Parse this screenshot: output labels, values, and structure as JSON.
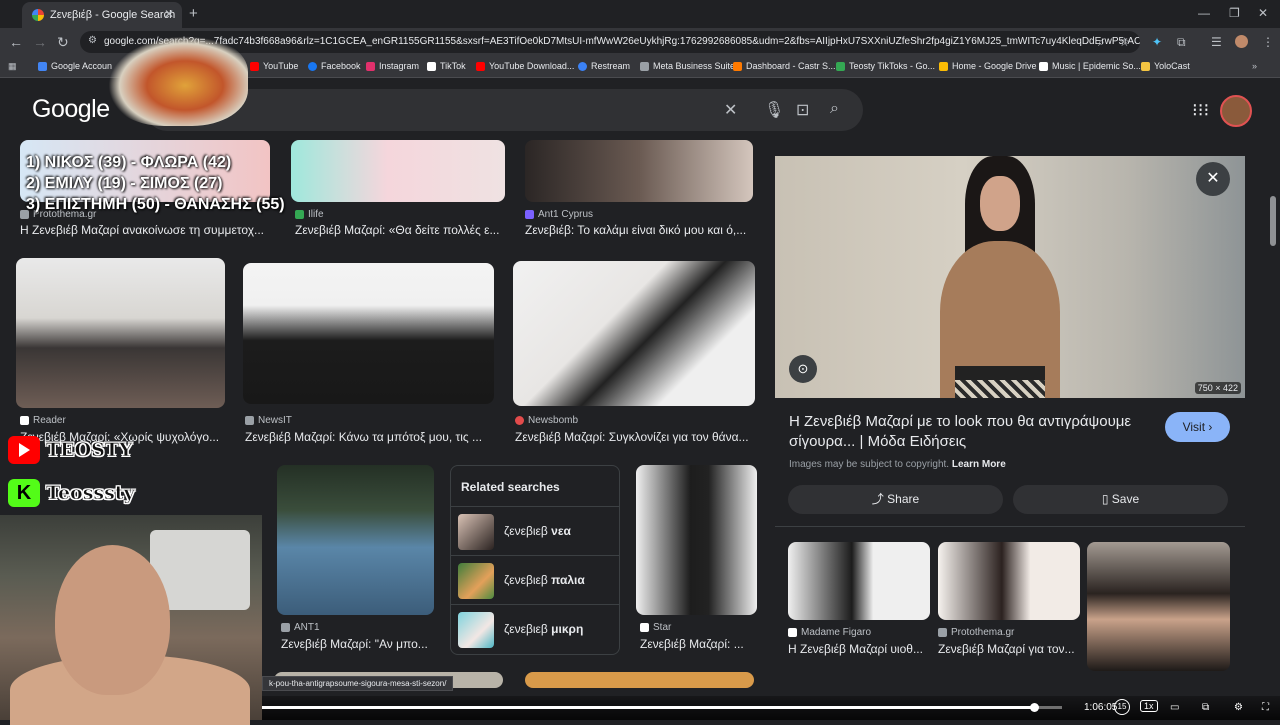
{
  "browser": {
    "tab_title": "Ζενεβιέβ - Google Search",
    "url": "google.com/search?q=...7fadc74b3f668a96&rlz=1C1GCEA_enGR1155GR1155&sxsrf=AE3TifOe0kD7MtsUI-mfWwW26eUykhjRg:1762992686085&udm=2&fbs=AIIjpHxU7SXXniUZfeShr2fp4giZ1Y6MJ25_tmWITc7uy4KleqDdErwP5rACeJA...",
    "bookmarks": [
      {
        "label": "Google Accoun",
        "color": "#4285f4"
      },
      {
        "label": "YouTube",
        "color": "#ff0000"
      },
      {
        "label": "Facebook",
        "color": "#1877f2"
      },
      {
        "label": "Instagram",
        "color": "#e1306c"
      },
      {
        "label": "TikTok",
        "color": "#ffffff"
      },
      {
        "label": "YouTube Download...",
        "color": "#ff0000"
      },
      {
        "label": "Restream",
        "color": "#3b82f6"
      },
      {
        "label": "Meta Business Suite",
        "color": "#9aa0a6"
      },
      {
        "label": "Dashboard - Castr S...",
        "color": "#ff7a00"
      },
      {
        "label": "Teosty TikToks - Go...",
        "color": "#34a853"
      },
      {
        "label": "Home - Google Drive",
        "color": "#fbbc05"
      },
      {
        "label": "Music | Epidemic So...",
        "color": "#ffffff"
      },
      {
        "label": "YoloCast",
        "color": "#f4c542"
      }
    ]
  },
  "google": {
    "logo": "Google",
    "search_value": ""
  },
  "overlay": {
    "line1": "1) ΝΙΚΟΣ (39) - ΦΛΩΡΑ (42)",
    "line2": "2) ΕΜΙΛΥ (19) - ΣΙΜΟΣ (27)",
    "line3": "3) ΕΠΙΣΤΗΜΗ (50) - ΘΑΝΑΣΗΣ (55)",
    "youtube_name": "TEOSTY",
    "kick_name": "Teosssty"
  },
  "results": [
    {
      "source": "Protothema.gr",
      "caption": "Η Ζενεβιέβ Μαζαρί ανακοίνωσε τη συμμετοχ...",
      "color": "#9aa0a6"
    },
    {
      "source": "Ilife",
      "caption": "Ζενεβιέβ Μαζαρί: «Θα δείτε πολλές ε...",
      "color": "#34a853"
    },
    {
      "source": "Ant1 Cyprus",
      "caption": "Ζενεβιέβ: Το καλάμι είναι δικό μου και ό,...",
      "color": "#7b61ff"
    },
    {
      "source": "Reader",
      "caption": "Ζενεβιέβ Μαζαρί: «Χωρίς ψυχολόγο...",
      "color": "#ffffff"
    },
    {
      "source": "NewsIT",
      "caption": "Ζενεβιέβ Μαζαρί: Κάνω τα μπότοξ μου, τις ...",
      "color": "#9aa0a6"
    },
    {
      "source": "Newsbomb",
      "caption": "Ζενεβιέβ Μαζαρί: Συγκλονίζει για τον θάνα...",
      "color": "#e24b4b"
    },
    {
      "source": "ANT1",
      "caption": "Ζενεβιέβ Μαζαρί: \"Αν μπο...",
      "color": "#9aa0a6"
    },
    {
      "source": "Star",
      "caption": "Ζενεβιέβ Μαζαρί: ...",
      "color": "#ffffff"
    }
  ],
  "related": {
    "title": "Related searches",
    "items": [
      {
        "base": "ζενεβιεβ",
        "bold": "νεα"
      },
      {
        "base": "ζενεβιεβ",
        "bold": "παλια"
      },
      {
        "base": "ζενεβιεβ",
        "bold": "μικρη"
      }
    ]
  },
  "panel": {
    "dimensions": "750 × 422",
    "title": "Η Ζενεβιέβ Μαζαρί με το look που θα αντιγράψουμε σίγουρα... | Μόδα Ειδήσεις",
    "visit_label": "Visit",
    "copyright": "Images may be subject to copyright.",
    "learn_more": "Learn More",
    "share_label": "Share",
    "save_label": "Save",
    "similar": [
      {
        "source": "Madame Figaro",
        "caption": "Η Ζενεβιέβ Μαζαρί υιοθ...",
        "color": "#ffffff"
      },
      {
        "source": "Protothema.gr",
        "caption": "Ζενεβιέβ Μαζαρί για τον...",
        "color": "#9aa0a6"
      }
    ]
  },
  "status_url": "k-pou-tha-antigrapsoume-sigoura-mesa-sti-sezon/",
  "video": {
    "time": "1:06:05",
    "progress": 0.965,
    "speed": "1x",
    "skip": "15"
  }
}
